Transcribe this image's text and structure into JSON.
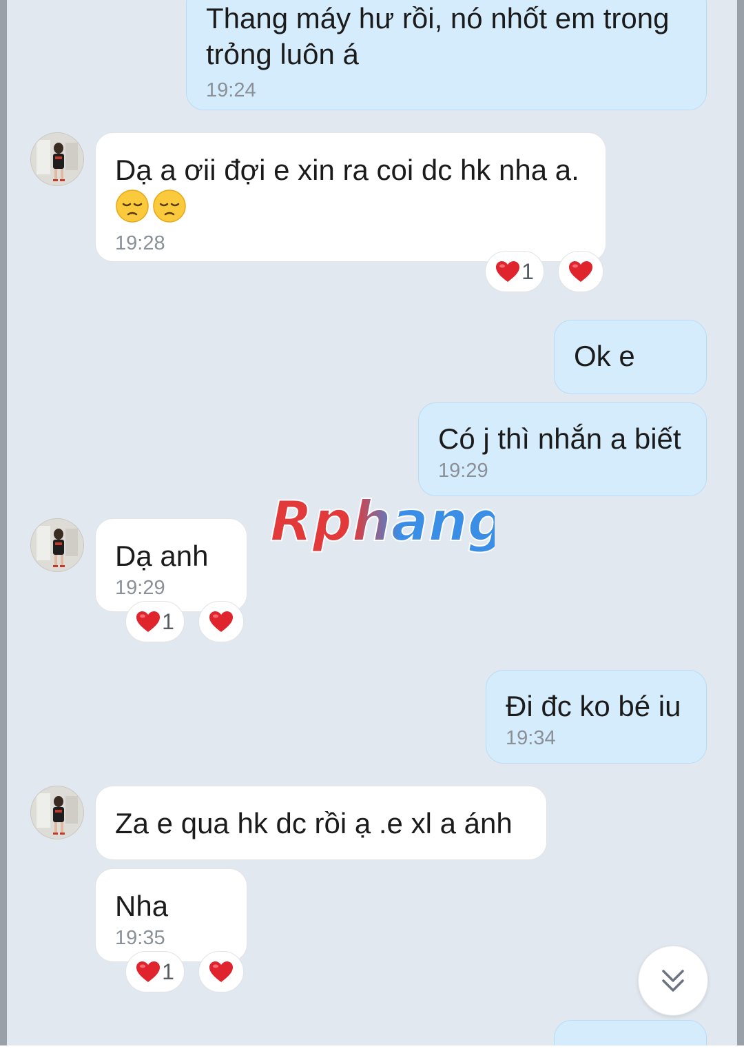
{
  "messages": [
    {
      "direction": "out",
      "text": "Thang máy hư rồi, nó nhốt em trong trỏng luôn á",
      "time": "19:24"
    },
    {
      "direction": "in",
      "text": "Dạ a ơii đợi e xin ra coi dc hk nha a.",
      "emoji": [
        "pensive-face",
        "pensive-face"
      ],
      "time": "19:28",
      "reaction_count": "1"
    },
    {
      "direction": "out",
      "text": "Ok e"
    },
    {
      "direction": "out",
      "text": "Có j thì nhắn a biết",
      "time": "19:29"
    },
    {
      "direction": "in",
      "text": "Dạ anh",
      "time": "19:29",
      "reaction_count": "1"
    },
    {
      "direction": "out",
      "text": "Đi đc ko bé iu",
      "time": "19:34"
    },
    {
      "direction": "in",
      "text": "Za e qua hk dc rồi ạ .e xl a ánh"
    },
    {
      "direction": "in",
      "text": "Nha",
      "time": "19:35",
      "reaction_count": "1"
    }
  ],
  "watermark": "Rphang",
  "icons": {
    "reaction": "heart-icon",
    "scroll": "double-chevron-down-icon",
    "emoji": "pensive-face-icon"
  },
  "colors": {
    "outgoing_bubble": "#d5ecfc",
    "incoming_bubble": "#ffffff",
    "chat_background": "#e2e8f0",
    "heart": "#e0242e",
    "watermark_red": "#e23a3a",
    "watermark_blue": "#3a8ee6"
  }
}
